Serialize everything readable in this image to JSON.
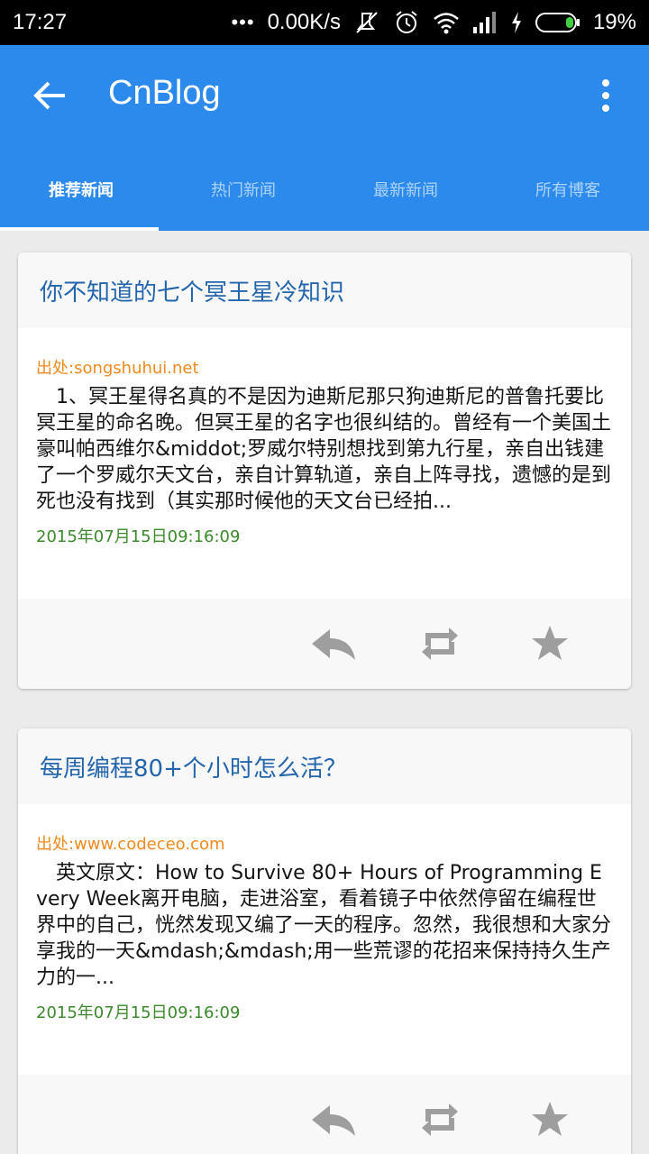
{
  "status_bar": {
    "time": "17:27",
    "network_speed": "0.00K/s",
    "battery": "19%",
    "icons": [
      "more-dots-icon",
      "mute-icon",
      "alarm-icon",
      "wifi-icon",
      "signal-icon",
      "charging-icon",
      "battery-icon"
    ]
  },
  "app_bar": {
    "title": "CnBlog",
    "back_icon": "arrow-left-icon",
    "menu_icon": "more-vertical-icon",
    "color": "#2b8aec"
  },
  "tabs": [
    {
      "label": "推荐新闻",
      "active": true
    },
    {
      "label": "热门新闻",
      "active": false
    },
    {
      "label": "最新新闻",
      "active": false
    },
    {
      "label": "所有博客",
      "active": false
    }
  ],
  "cards": [
    {
      "title": "你不知道的七个冥王星冷知识",
      "source": "出处:songshuhui.net",
      "summary": "　1、冥王星得名真的不是因为迪斯尼那只狗迪斯尼的普鲁托要比冥王星的命名晚。但冥王星的名字也很纠结的。曾经有一个美国土豪叫帕西维尔&middot;罗威尔特别想找到第九行星，亲自出钱建了一个罗威尔天文台，亲自计算轨道，亲自上阵寻找，遗憾的是到死也没有找到（其实那时候他的天文台已经拍...",
      "time": "2015年07月15日09:16:09"
    },
    {
      "title": "每周编程80+个小时怎么活？",
      "source": "出处:www.codeceo.com",
      "summary": "　英文原文：How to Survive 80+ Hours of Programming Every Week离开电脑，走进浴室，看着镜子中依然停留在编程世界中的自己，恍然发现又编了一天的程序。忽然，我很想和大家分享我的一天&mdash;&mdash;用一些荒谬的花招来保持持久生产力的一...",
      "time": "2015年07月15日09:16:09"
    }
  ],
  "colors": {
    "title": "#2366ad",
    "source": "#f08a1e",
    "time": "#3b8a2c",
    "icon": "#9e9e9e"
  }
}
